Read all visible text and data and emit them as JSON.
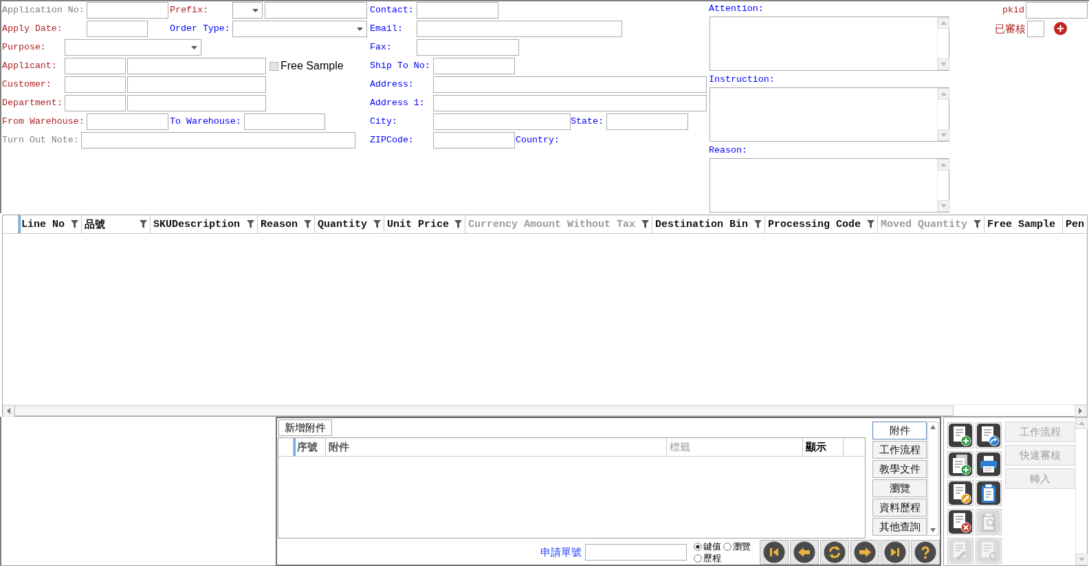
{
  "header_form": {
    "rows": [
      {
        "fields": [
          {
            "kind": "text",
            "label": "Application No:",
            "color": "#808080"
          },
          {
            "kind": "select_text",
            "label": "Prefix:",
            "color": "#b22222"
          },
          {
            "kind": "text",
            "label": "Contact:",
            "color": "#0000ff"
          }
        ]
      },
      {
        "fields": [
          {
            "kind": "text",
            "label": "Apply Date:",
            "color": "#b22222"
          },
          {
            "kind": "select",
            "label": "Order Type:",
            "color": "#0000ff"
          },
          {
            "kind": "text",
            "label": "Email:",
            "color": "#0000ff"
          }
        ]
      },
      {
        "fields": [
          {
            "kind": "select",
            "label": "Purpose:",
            "color": "#b22222"
          },
          {
            "kind": "text",
            "label": "Fax:",
            "color": "#0000ff"
          }
        ]
      },
      {
        "fields": [
          {
            "kind": "pair",
            "label": "Applicant:",
            "color": "#b22222"
          },
          {
            "kind": "checkbox",
            "label": "Free Sample",
            "checked": false
          },
          {
            "kind": "text",
            "label": "Ship To No:",
            "color": "#0000ff"
          }
        ]
      },
      {
        "fields": [
          {
            "kind": "pair",
            "label": "Customer:",
            "color": "#b22222"
          },
          {
            "kind": "text",
            "label": "Address:",
            "color": "#0000ff"
          }
        ]
      },
      {
        "fields": [
          {
            "kind": "pair",
            "label": "Department:",
            "color": "#b22222"
          },
          {
            "kind": "text",
            "label": "Address 1:",
            "color": "#0000ff"
          }
        ]
      },
      {
        "fields": [
          {
            "kind": "text",
            "label": "From Warehouse:",
            "color": "#b22222"
          },
          {
            "kind": "text",
            "label": "To Warehouse:",
            "color": "#0000ff"
          },
          {
            "kind": "text",
            "label": "City:",
            "color": "#0000ff"
          },
          {
            "kind": "text",
            "label": "State:",
            "color": "#0000ff"
          }
        ]
      },
      {
        "fields": [
          {
            "kind": "text",
            "label": "Turn Out Note:",
            "color": "#808080"
          },
          {
            "kind": "text",
            "label": "ZIPCode:",
            "color": "#0000ff"
          },
          {
            "kind": "label",
            "label": "Country:",
            "color": "#0000ff"
          }
        ]
      }
    ]
  },
  "notes": [
    {
      "label": "Attention:"
    },
    {
      "label": "Instruction:"
    },
    {
      "label": "Reason:"
    }
  ],
  "record_key": {
    "pkid": {
      "label": "pkid"
    },
    "approved": {
      "label": "已審核"
    }
  },
  "grid": {
    "columns": [
      {
        "label": "Line No",
        "filter": true,
        "dimmed": false
      },
      {
        "label": "品號",
        "filter": true,
        "dimmed": false
      },
      {
        "label": "SKUDescription",
        "filter": true,
        "dimmed": false
      },
      {
        "label": "Reason",
        "filter": true,
        "dimmed": false
      },
      {
        "label": "Quantity",
        "filter": true,
        "dimmed": false
      },
      {
        "label": "Unit Price",
        "filter": true,
        "dimmed": false
      },
      {
        "label": "Currency Amount Without Tax",
        "filter": true,
        "dimmed": true
      },
      {
        "label": "Destination Bin",
        "filter": true,
        "dimmed": false
      },
      {
        "label": "Processing Code",
        "filter": true,
        "dimmed": false
      },
      {
        "label": "Moved Quantity",
        "filter": true,
        "dimmed": true
      },
      {
        "label": "Free Sample",
        "filter": false,
        "dimmed": false
      },
      {
        "label": "Pen",
        "filter": false,
        "dimmed": false
      }
    ]
  },
  "attachments": {
    "add_button": "新增附件",
    "columns": [
      {
        "label": "序號",
        "dimmed": false
      },
      {
        "label": "附件",
        "dimmed": false
      },
      {
        "label": "標籤",
        "dimmed": true
      },
      {
        "label": "顯示",
        "dimmed": false
      }
    ],
    "side_tabs": [
      {
        "label": "附件",
        "selected": true
      },
      {
        "label": "工作流程",
        "selected": false
      },
      {
        "label": "教學文件",
        "selected": false
      },
      {
        "label": "瀏覽",
        "selected": false
      },
      {
        "label": "資料歷程",
        "selected": false
      },
      {
        "label": "其他查詢",
        "selected": false
      }
    ]
  },
  "navigation": {
    "lookup_label": "申請單號",
    "view_mode": [
      {
        "label": "鍵值",
        "selected": true
      },
      {
        "label": "瀏覽",
        "selected": false
      },
      {
        "label": "歷程",
        "selected": false
      }
    ]
  },
  "tool_panel": {
    "icon_buttons": [
      {
        "kind": "new",
        "disabled": false
      },
      {
        "kind": "export",
        "disabled": false
      },
      {
        "kind": "copy",
        "disabled": false
      },
      {
        "kind": "print",
        "disabled": false
      },
      {
        "kind": "edit",
        "disabled": false
      },
      {
        "kind": "paste",
        "disabled": false
      },
      {
        "kind": "delete",
        "disabled": false
      },
      {
        "kind": "find",
        "disabled": true
      },
      {
        "kind": "annotate",
        "disabled": true
      },
      {
        "kind": "reload",
        "disabled": true
      }
    ],
    "action_buttons": [
      {
        "label": "工作流程",
        "disabled": true
      },
      {
        "label": "快速審核",
        "disabled": true
      },
      {
        "label": "轉入",
        "disabled": true
      }
    ]
  }
}
